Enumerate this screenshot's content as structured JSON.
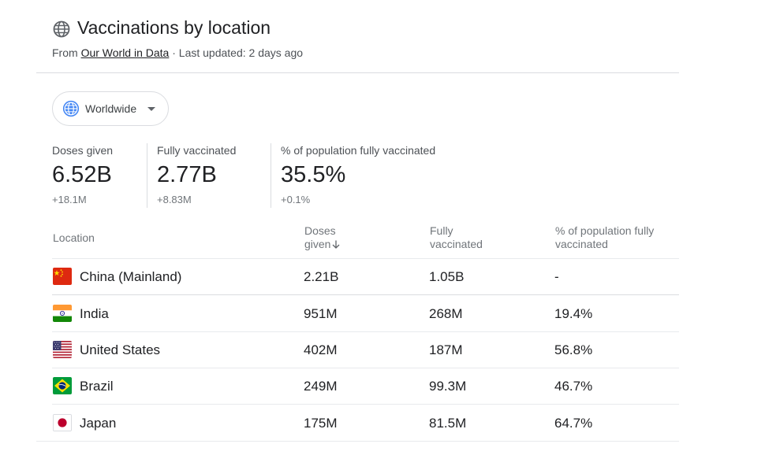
{
  "header": {
    "title": "Vaccinations by location",
    "source_prefix": "From",
    "source_link": "Our World in Data",
    "updated": "· Last updated: 2 days ago"
  },
  "location_selector": {
    "label": "Worldwide",
    "icon": "globe-icon"
  },
  "stats": [
    {
      "label": "Doses given",
      "value": "6.52B",
      "change": "+18.1M"
    },
    {
      "label": "Fully vaccinated",
      "value": "2.77B",
      "change": "+8.83M"
    },
    {
      "label": "% of population fully vaccinated",
      "value": "35.5%",
      "change": "+0.1%"
    }
  ],
  "table": {
    "columns": [
      {
        "line1": "Location",
        "line2": ""
      },
      {
        "line1": "Doses",
        "line2": "given",
        "sort_icon": "arrow-down-icon"
      },
      {
        "line1": "Fully",
        "line2": "vaccinated"
      },
      {
        "line1": "% of population fully",
        "line2": "vaccinated"
      }
    ],
    "rows": [
      {
        "location": "China (Mainland)",
        "flag": "china-flag-icon",
        "doses": "2.21B",
        "fully": "1.05B",
        "pct": "-"
      },
      {
        "location": "India",
        "flag": "india-flag-icon",
        "doses": "951M",
        "fully": "268M",
        "pct": "19.4%"
      },
      {
        "location": "United States",
        "flag": "us-flag-icon",
        "doses": "402M",
        "fully": "187M",
        "pct": "56.8%"
      },
      {
        "location": "Brazil",
        "flag": "brazil-flag-icon",
        "doses": "249M",
        "fully": "99.3M",
        "pct": "46.7%"
      },
      {
        "location": "Japan",
        "flag": "japan-flag-icon",
        "doses": "175M",
        "fully": "81.5M",
        "pct": "64.7%"
      }
    ]
  },
  "colors": {
    "globe_blue": "#4285f4",
    "text_primary": "#202124",
    "text_secondary": "#70757a",
    "divider": "#dadce0"
  }
}
